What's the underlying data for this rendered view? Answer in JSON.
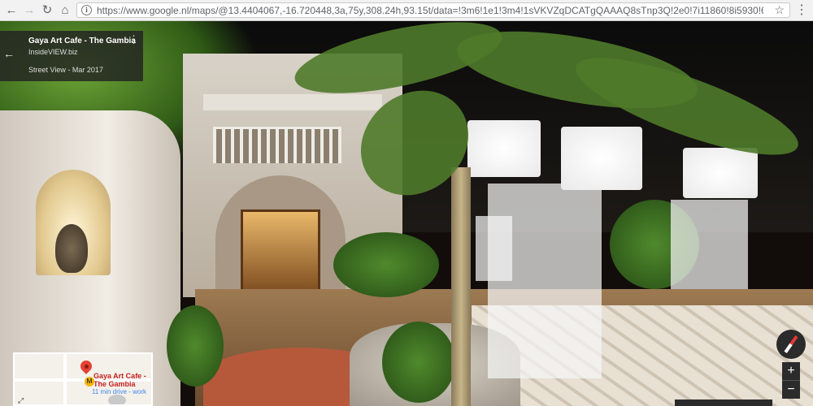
{
  "browser": {
    "url": "https://www.google.nl/maps/@13.4404067,-16.720448,3a,75y,308.24h,93.15t/data=!3m6!1e1!3m4!1sVKVZqDCATgQAAAQ8sTnp3Q!2e0!7i11860!8i5930!6m...",
    "back_icon": "arrow-left",
    "forward_icon": "arrow-right",
    "reload_icon": "reload",
    "home_icon": "home",
    "bookmark_icon": "star",
    "menu_icon": "vertical-dots"
  },
  "info_card": {
    "title": "Gaya Art Cafe - The Gambia",
    "author": "InsideVIEW.biz",
    "date": "Street View - Mar 2017"
  },
  "minimap": {
    "place_label": "Gaya Art Cafe - The Gambia",
    "sub_label": "11 min drive - work",
    "pegman_label": "M"
  },
  "controls": {
    "zoom_in": "+",
    "zoom_out": "−"
  },
  "colors": {
    "pin": "#e44134",
    "map_label": "#c5221f",
    "link": "#4285f4"
  }
}
